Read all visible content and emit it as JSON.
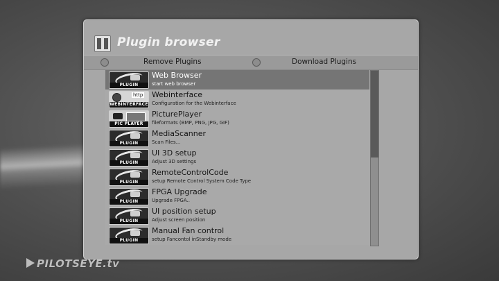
{
  "window": {
    "title": "Plugin browser"
  },
  "choices": [
    {
      "label": "Remove Plugins"
    },
    {
      "label": "Download Plugins"
    }
  ],
  "plugins": [
    {
      "title": "Web Browser",
      "subtitle": "start web browser",
      "thumb_label": "PLUGIN",
      "icon": "plugin-icon",
      "selected": true
    },
    {
      "title": "Webinterface",
      "subtitle": "Configuration for the Webinterface",
      "thumb_label": "WEBINTERFACE",
      "icon": "webinterface-icon",
      "selected": false
    },
    {
      "title": "PicturePlayer",
      "subtitle": "fileformats (BMP, PNG, JPG, GIF)",
      "thumb_label": "PIC PLAYER",
      "icon": "pic-player-icon",
      "selected": false
    },
    {
      "title": "MediaScanner",
      "subtitle": "Scan Files...",
      "thumb_label": "PLUGIN",
      "icon": "plugin-icon",
      "selected": false
    },
    {
      "title": "UI 3D setup",
      "subtitle": "Adjust 3D settings",
      "thumb_label": "PLUGIN",
      "icon": "plugin-icon",
      "selected": false
    },
    {
      "title": "RemoteControlCode",
      "subtitle": "setup Remote Control System Code Type",
      "thumb_label": "PLUGIN",
      "icon": "plugin-icon",
      "selected": false
    },
    {
      "title": "FPGA Upgrade",
      "subtitle": "Upgrade FPGA..",
      "thumb_label": "PLUGIN",
      "icon": "plugin-icon",
      "selected": false
    },
    {
      "title": "UI position setup",
      "subtitle": "Adjust screen position",
      "thumb_label": "PLUGIN",
      "icon": "plugin-icon",
      "selected": false
    },
    {
      "title": "Manual Fan control",
      "subtitle": "setup Fancontol inStandby mode",
      "thumb_label": "PLUGIN",
      "icon": "plugin-icon",
      "selected": false
    }
  ],
  "http_badge": "http",
  "scroll": {
    "visible_fraction": 0.5,
    "position": 0
  },
  "watermark": "PILOTSEYE.tv"
}
